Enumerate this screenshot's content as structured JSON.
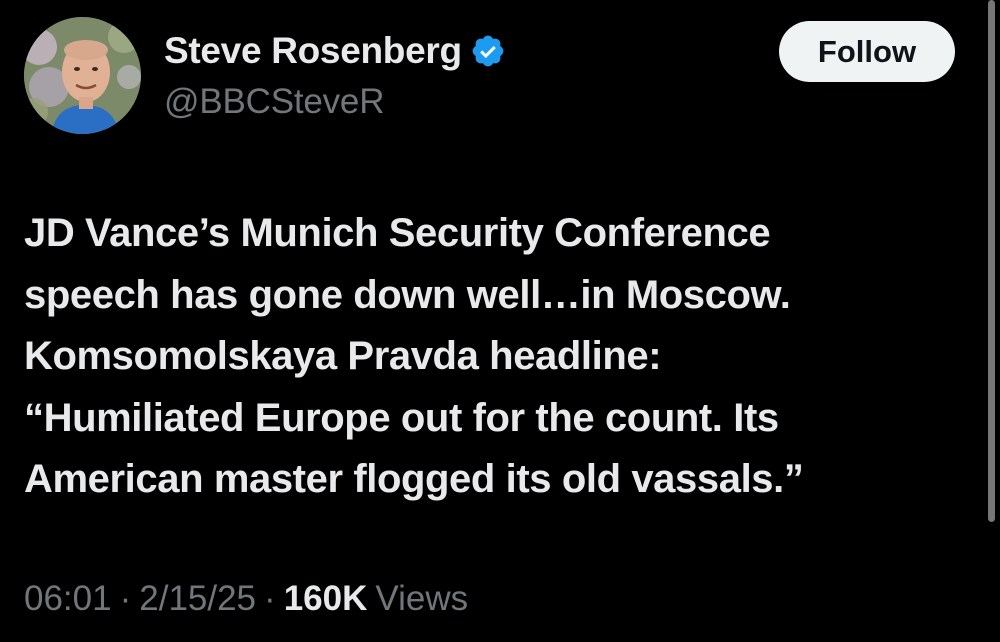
{
  "author": {
    "display_name": "Steve Rosenberg",
    "handle": "@BBCSteveR",
    "verified": true,
    "avatar_icon": "profile-photo"
  },
  "actions": {
    "follow_label": "Follow"
  },
  "tweet": {
    "text_lines": [
      "JD Vance’s Munich Security Conference",
      "speech has gone down well…in Moscow.",
      "Komsomolskaya Pravda headline:",
      "“Humiliated Europe out for the count. Its",
      "American master flogged its old vassals.”"
    ]
  },
  "meta": {
    "time": "06:01",
    "separator": "·",
    "date": "2/15/25",
    "views_count": "160K",
    "views_label": "Views"
  },
  "colors": {
    "background": "#000000",
    "primary_text": "#e7e9ea",
    "secondary_text": "#71767b",
    "verified_badge": "#1d9bf0",
    "follow_button_bg": "#eff3f4"
  }
}
